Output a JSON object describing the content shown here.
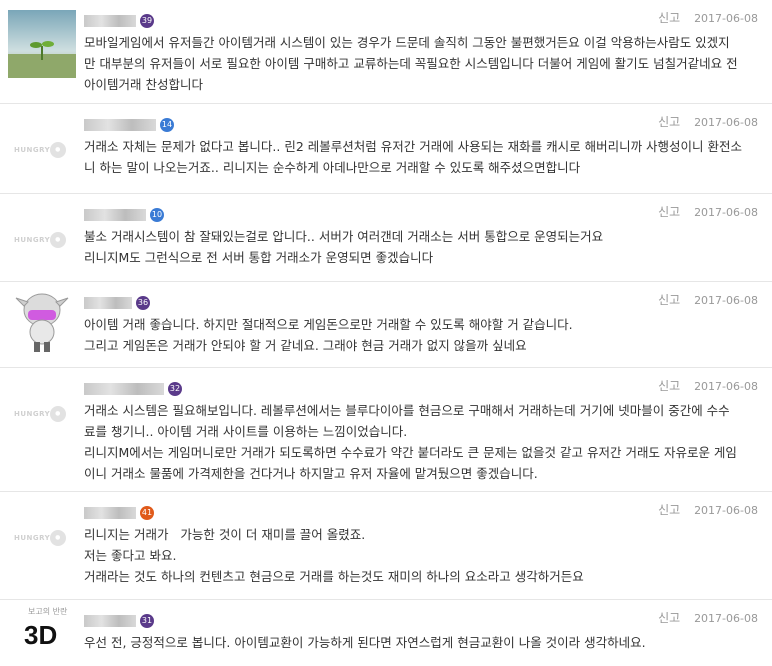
{
  "report_label": "신고",
  "hungry_logo_text": "HUNGRY",
  "comments": [
    {
      "date": "2017-06-08",
      "badge": {
        "text": "39",
        "color": "#5a3a8a"
      },
      "lines": [
        "모바일게임에서 유저들간 아이템거래 시스템이 있는 경우가 드문데 솔직히 그동안 불편했거든요 이걸 악용하는사람도 있겠지",
        "만 대부분의 유저들이 서로 필요한 아이템 구매하고 교류하는데 꼭필요한 시스템입니다 더불어 게임에 활기도 넘칠거같네요 전",
        "아이템거래 찬성합니다"
      ]
    },
    {
      "date": "2017-06-08",
      "badge": {
        "text": "14",
        "color": "#3a7bd5"
      },
      "lines": [
        "거래소 자체는 문제가 없다고 봅니다.. 린2 레볼루션처럼 유저간 거래에 사용되는 재화를 캐시로 해버리니까 사행성이니 환전소",
        "니 하는 말이 나오는거죠.. 리니지는 순수하게 아데나만으로 거래할 수 있도록 해주셨으면합니다"
      ]
    },
    {
      "date": "2017-06-08",
      "badge": {
        "text": "10",
        "color": "#3a7bd5"
      },
      "lines": [
        "불소 거래시스템이 참 잘돼있는걸로 압니다.. 서버가 여러갠데 거래소는 서버 통합으로 운영되는거요",
        "리니지M도 그런식으로 전 서버 통합 거래소가 운영되면 좋겠습니다"
      ]
    },
    {
      "date": "2017-06-08",
      "badge": {
        "text": "36",
        "color": "#5a3a8a"
      },
      "lines": [
        "아이템 거래 좋습니다. 하지만 절대적으로 게임돈으로만 거래할 수 있도록 해야할 거 같습니다.",
        "그리고 게임돈은 거래가 안되야 할 거 같네요. 그래야 현금 거래가 없지 않을까 싶네요"
      ]
    },
    {
      "date": "2017-06-08",
      "badge": {
        "text": "32",
        "color": "#5a3a8a"
      },
      "lines": [
        "거래소 시스템은 필요해보입니다. 레볼루션에서는 블루다이아를 현금으로 구매해서 거래하는데 거기에 넷마블이 중간에 수수",
        "료를 챙기니.. 아이템 거래 사이트를 이용하는 느낌이었습니다.",
        "리니지M에서는 게임머니로만 거래가 되도록하면 수수료가 약간 붙더라도 큰 문제는 없을것 같고 유저간 거래도 자유로운 게임",
        "이니 거래소 물품에 가격제한을 건다거나 하지말고 유저 자율에 맡겨뒀으면 좋겠습니다."
      ]
    },
    {
      "date": "2017-06-08",
      "badge": {
        "text": "41",
        "color": "#e05a1a"
      },
      "lines": [
        "리니지는 거래가   가능한 것이 더 재미를 끌어 올렸죠.",
        "저는 좋다고 봐요.",
        "거래라는 것도 하나의 컨텐츠고 현금으로 거래를 하는것도 재미의 하나의 요소라고 생각하거든요"
      ]
    },
    {
      "date": "2017-06-08",
      "badge": {
        "text": "31",
        "color": "#5a3a8a"
      },
      "avatar_small_text": "보고의 반란",
      "avatar_big_text": "3D",
      "lines": [
        "우선 전, 긍정적으로 봅니다. 아이템교환이 가능하게 된다면 자연스럽게 현금교환이 나올 것이라 생각하네요."
      ]
    }
  ]
}
